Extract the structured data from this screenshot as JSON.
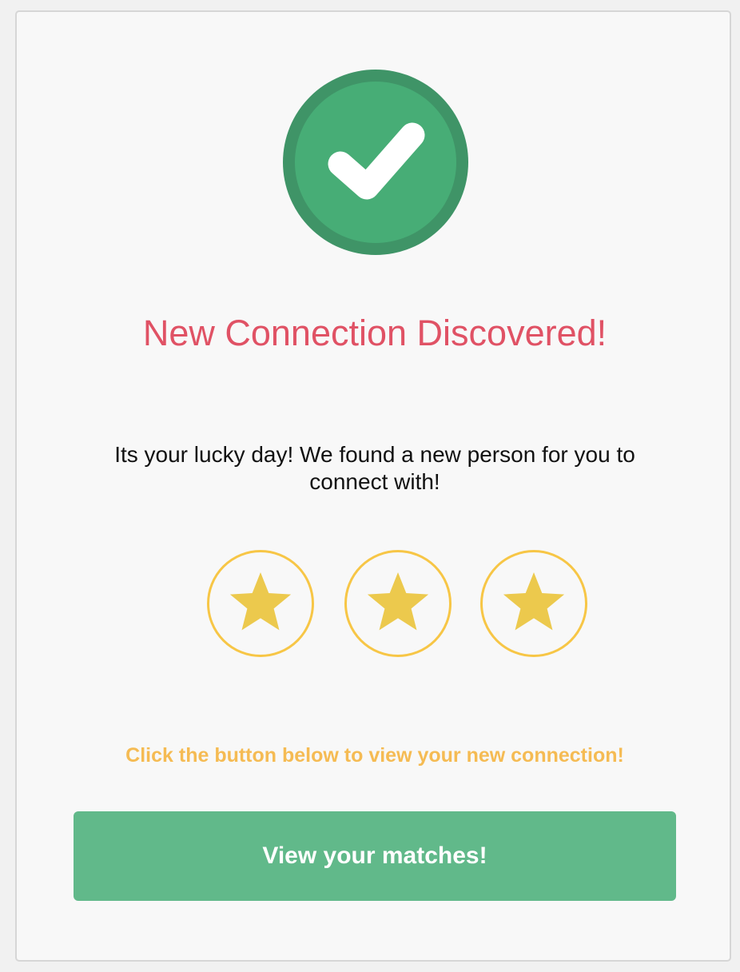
{
  "card": {
    "badge_icon": "check-circle-icon",
    "title": "New Connection Discovered!",
    "message": "Its your lucky day! We found a new person for you to connect with!",
    "rating": {
      "stars_filled": 3,
      "stars_total": 3,
      "icon": "star-icon"
    },
    "hint": "Click the button below to view your new connection!",
    "button_label": "View your matches!"
  },
  "colors": {
    "title": "#e05265",
    "badge_outer": "#3f9467",
    "badge_inner": "#47ad76",
    "star_fill": "#ecc94d",
    "star_ring": "#f7c646",
    "hint": "#f5bb53",
    "button": "#61b98a"
  }
}
